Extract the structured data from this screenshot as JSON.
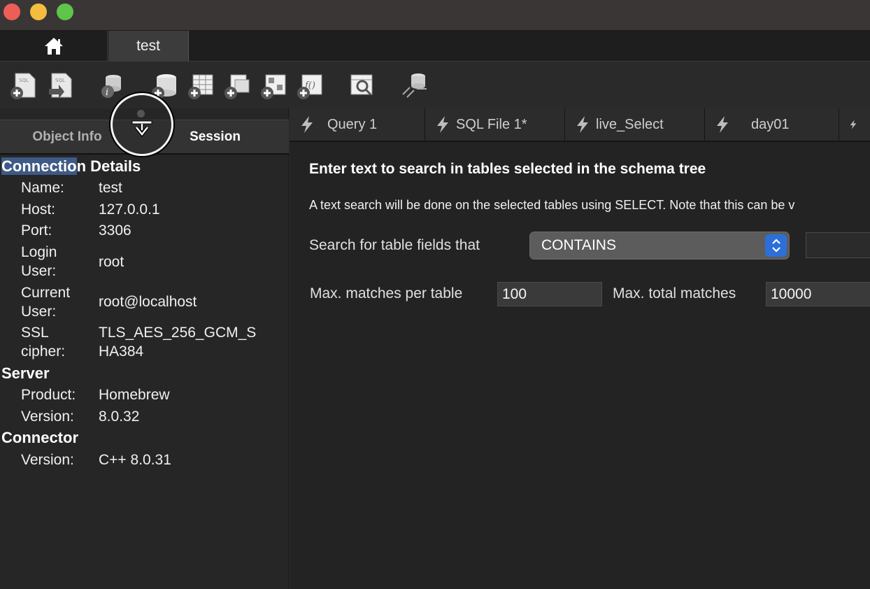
{
  "window": {
    "traffic_lights": [
      "close",
      "minimize",
      "zoom"
    ]
  },
  "connection_tabs": {
    "home_icon": "home-icon",
    "active": "test"
  },
  "toolbar": {
    "buttons": [
      "new-sql-tab-icon",
      "open-sql-file-icon",
      "schema-inspector-icon",
      "create-schema-icon",
      "create-table-icon",
      "create-view-icon",
      "create-procedure-icon",
      "create-function-icon",
      "search-table-data-icon",
      "reconnect-icon"
    ]
  },
  "left_panel": {
    "segments": {
      "object_info": "Object Info",
      "session": "Session"
    },
    "sections": {
      "connection": {
        "heading_highlight": "Connectio",
        "heading_rest": "n Details",
        "name_label": "Name:",
        "name_value": "test",
        "host_label": "Host:",
        "host_value": "127.0.0.1",
        "port_label": "Port:",
        "port_value": "3306",
        "login_label_1": "Login",
        "login_label_2": "User:",
        "login_value": "root",
        "current_label_1": "Current",
        "current_label_2": "User:",
        "current_value": "root@localhost",
        "ssl_label_1": "SSL",
        "ssl_label_2": "cipher:",
        "ssl_value_1": "TLS_AES_256_GCM_S",
        "ssl_value_2": "HA384"
      },
      "server": {
        "heading": "Server",
        "product_label": "Product:",
        "product_value": "Homebrew",
        "version_label": "Version:",
        "version_value": "8.0.32"
      },
      "connector": {
        "heading": "Connector",
        "version_label": "Version:",
        "version_value": "C++ 8.0.31"
      }
    }
  },
  "query_tabs": [
    "Query 1",
    "SQL File 1*",
    "live_Select",
    "day01",
    ""
  ],
  "search_panel": {
    "title": "Enter text to search in tables selected in the schema tree",
    "description": "A text search will be done on the selected tables using SELECT. Note that this can be v",
    "fields_label": "Search for table fields that",
    "operator": "CONTAINS",
    "max_per_table_label": "Max. matches per table",
    "max_per_table": "100",
    "max_total_label": "Max. total matches",
    "max_total": "10000"
  }
}
